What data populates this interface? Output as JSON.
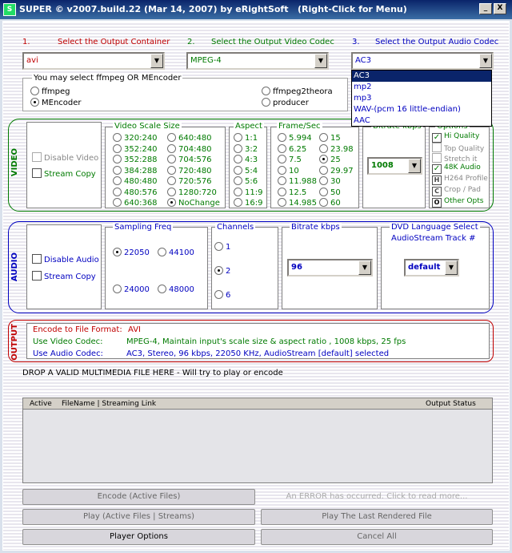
{
  "window": {
    "title": "SUPER © v2007.build.22 (Mar 14, 2007) by eRightSoft",
    "hint": "(Right-Click for Menu)",
    "min": "_",
    "close": "X"
  },
  "steps": {
    "container": {
      "num": "1.",
      "label": "Select the Output Container",
      "value": "avi"
    },
    "video_codec": {
      "num": "2.",
      "label": "Select the Output Video Codec",
      "value": "MPEG-4"
    },
    "audio_codec": {
      "num": "3.",
      "label": "Select the Output Audio Codec",
      "value": "AC3",
      "options": [
        "AC3",
        "mp2",
        "mp3",
        "WAV-(pcm 16 little-endian)",
        "AAC"
      ]
    }
  },
  "encoder": {
    "title": "You may select ffmpeg OR MEncoder",
    "opt1": "ffmpeg",
    "opt2": "MEncoder",
    "opt3": "ffmpeg2theora",
    "opt4": "producer"
  },
  "video": {
    "label": "VIDEO",
    "disable": "Disable Video",
    "stream_copy": "Stream Copy",
    "scale_title": "Video Scale Size",
    "scale_col1": [
      "320:240",
      "352:240",
      "352:288",
      "384:288",
      "480:480",
      "480:576",
      "640:368"
    ],
    "scale_col2": [
      "640:480",
      "704:480",
      "704:576",
      "720:480",
      "720:576",
      "1280:720",
      "NoChange"
    ],
    "aspect_title": "Aspect",
    "aspect": [
      "1:1",
      "3:2",
      "4:3",
      "5:4",
      "5:6",
      "11:9",
      "16:9"
    ],
    "fps_title": "Frame/Sec",
    "fps_col1": [
      "5.994",
      "6.25",
      "7.5",
      "10",
      "11.988",
      "12.5",
      "14.985"
    ],
    "fps_col2": [
      "15",
      "23.98",
      "25",
      "29.97",
      "30",
      "50",
      "60"
    ],
    "bitrate_title": "Bitrate  kbps",
    "bitrate": "1008",
    "options_title": "Options",
    "opts": [
      "Hi Quality",
      "Top Quality",
      "Stretch it",
      "48K Audio"
    ],
    "h264": "H264 Profile",
    "crop": "Crop / Pad",
    "other": "Other Opts",
    "h_icon": "H",
    "c_icon": "C",
    "o_icon": "O"
  },
  "audio": {
    "label": "AUDIO",
    "disable": "Disable Audio",
    "stream_copy": "Stream Copy",
    "freq_title": "Sampling Freq",
    "freq": [
      "22050",
      "44100",
      "24000",
      "48000"
    ],
    "channels_title": "Channels",
    "channels": [
      "1",
      "2",
      "6"
    ],
    "bitrate_title": "Bitrate  kbps",
    "bitrate": "96",
    "dvd_title": "DVD Language Select",
    "dvd_sub": "AudioStream  Track #",
    "dvd_value": "default"
  },
  "output": {
    "label": "OUTPUT",
    "format_label": "Encode to File Format:",
    "format_value": "AVI",
    "video_label": "Use Video Codec:",
    "video_value": "MPEG-4,  Maintain input's scale size & aspect ratio ,  1008 kbps,  25 fps",
    "audio_label": "Use Audio Codec:",
    "audio_value": "AC3,  Stereo,  96 kbps,  22050 KHz,  AudioStream [default] selected"
  },
  "drop_text": "DROP A VALID MULTIMEDIA FILE HERE - Will try to play or encode",
  "table": {
    "col1": "Active",
    "col2": "FileName  |  Streaming Link",
    "col3": "Output Status"
  },
  "buttons": {
    "encode": "Encode (Active Files)",
    "error": "An ERROR has occurred. Click to read more...",
    "play_active": "Play (Active Files | Streams)",
    "play_last": "Play The Last Rendered File",
    "player_options": "Player Options",
    "cancel_all": "Cancel All"
  },
  "colors": {
    "red": "#c00000",
    "green": "#007a00",
    "blue": "#0000c0",
    "title_bg": "#0a246a"
  }
}
